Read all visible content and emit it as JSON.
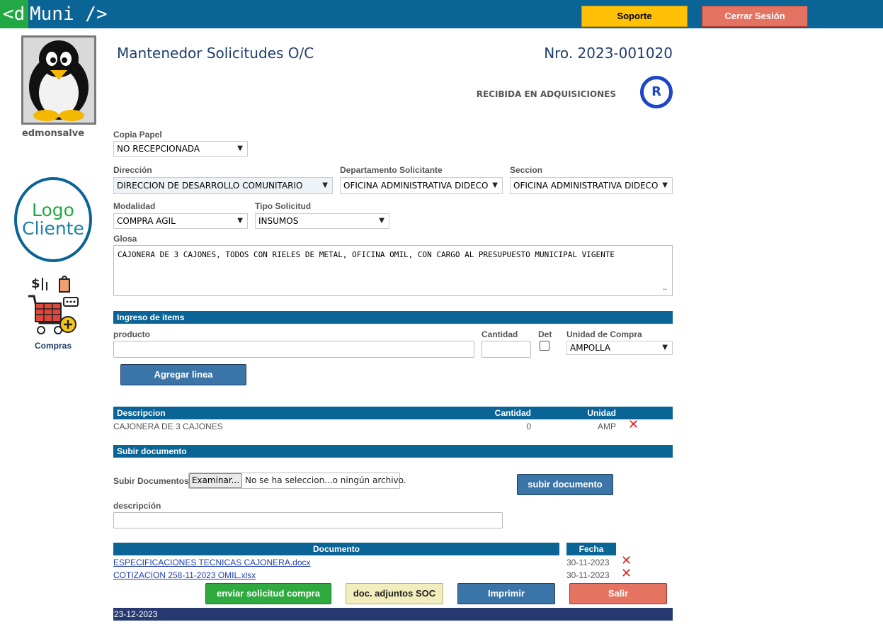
{
  "app": {
    "brand_lt": "<d",
    "brand_name": "Muni />"
  },
  "topbar": {
    "soporte_label": "Soporte",
    "cerrar_label": "Cerrar Sesión"
  },
  "sidebar": {
    "username": "edmonsalve",
    "logo_line1": "Logo",
    "logo_line2": "Cliente",
    "compras_label": "Compras"
  },
  "header": {
    "title": "Mantenedor Solicitudes O/C",
    "number": "Nro. 2023-001020",
    "status_text": "RECIBIDA EN ADQUISICIONES",
    "status_badge": "R"
  },
  "form": {
    "copia_label": "Copia Papel",
    "copia_value": "NO RECEPCIONADA",
    "direccion_label": "Dirección",
    "direccion_value": "DIRECCION DE DESARROLLO COMUNITARIO",
    "departamento_label": "Departamento Solicitante",
    "departamento_value": "OFICINA ADMINISTRATIVA DIDECO",
    "seccion_label": "Seccion",
    "seccion_value": "OFICINA ADMINISTRATIVA DIDECO",
    "modalidad_label": "Modalidad",
    "modalidad_value": "COMPRA AGIL",
    "tipo_label": "Tipo Solicitud",
    "tipo_value": "INSUMOS",
    "glosa_label": "Glosa",
    "glosa_value": "CAJONERA DE 3 CAJONES, TODOS CON RIELES DE METAL, OFICINA OMIL, CON CARGO AL PRESUPUESTO MUNICIPAL VIGENTE"
  },
  "items": {
    "section_title": "Ingreso de items",
    "producto_label": "producto",
    "cantidad_label": "Cantidad",
    "det_label": "Det",
    "unidad_label": "Unidad de Compra",
    "unidad_value": "AMPOLLA",
    "add_button": "Agregar linea",
    "table_headers": {
      "descripcion": "Descripcion",
      "cantidad": "Cantidad",
      "unidad": "Unidad"
    },
    "rows": [
      {
        "descripcion": "CAJONERA DE 3 CAJONES",
        "cantidad": "0",
        "unidad": "AMP"
      }
    ]
  },
  "upload": {
    "section_title": "Subir documento",
    "label": "Subir Documentos",
    "browse_label": "Examinar...",
    "file_status": "No se ha seleccion...o ningún archivo.",
    "submit_label": "subir documento",
    "descripcion_label": "descripción"
  },
  "documents": {
    "header_documento": "Documento",
    "header_fecha": "Fecha",
    "rows": [
      {
        "name": "ESPECIFICACIONES TECNICAS CAJONERA.docx",
        "date": "30-11-2023"
      },
      {
        "name": "COTIZACION 258-11-2023 OMIL.xlsx",
        "date": "30-11-2023"
      }
    ]
  },
  "actions": {
    "enviar_label": "enviar solicitud compra",
    "adjuntos_label": "doc. adjuntos SOC",
    "imprimir_label": "Imprimir",
    "salir_label": "Salir"
  },
  "footer": {
    "date": "23-12-2023"
  },
  "colors": {
    "primary": "#0a6496",
    "brand_green": "#23a846",
    "soporte": "#ffc107",
    "cerrar": "#e57362",
    "footer": "#263a70"
  }
}
